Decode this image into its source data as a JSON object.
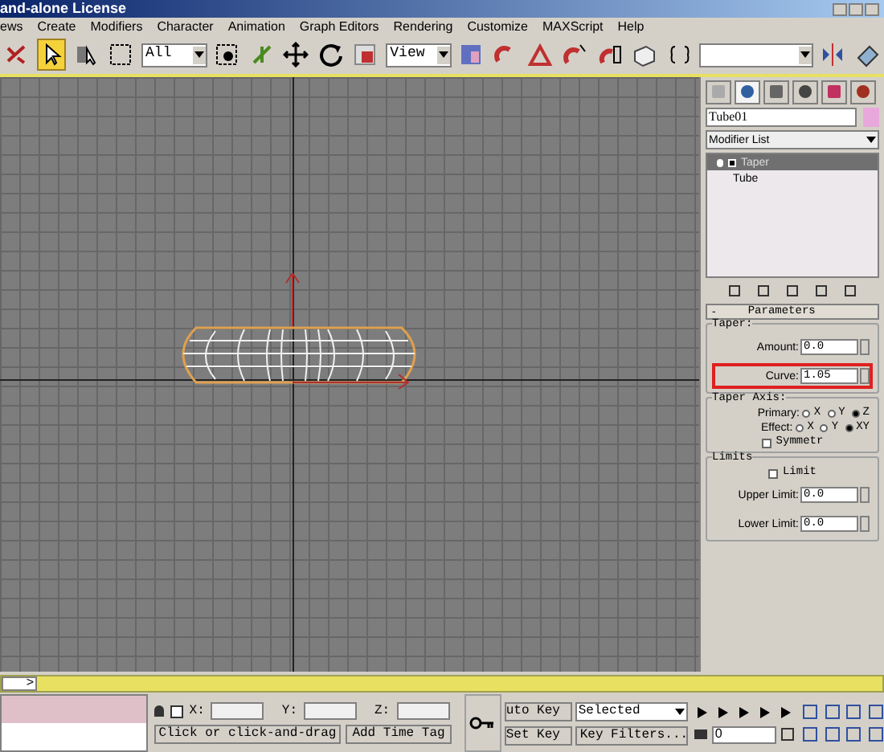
{
  "window": {
    "title": "and-alone License"
  },
  "menu": [
    "ews",
    "Create",
    "Modifiers",
    "Character",
    "Animation",
    "Graph Editors",
    "Rendering",
    "Customize",
    "MAXScript",
    "Help"
  ],
  "toolbar": {
    "tools": [
      {
        "kind": "link",
        "selected": false
      },
      {
        "kind": "select",
        "selected": true
      },
      {
        "kind": "select-name",
        "selected": false
      },
      {
        "kind": "region",
        "selected": false
      },
      {
        "kind": "filter",
        "value": "All"
      },
      {
        "kind": "target",
        "selected": false
      },
      {
        "kind": "manipulate",
        "selected": false
      },
      {
        "kind": "move",
        "selected": false
      },
      {
        "kind": "rotate",
        "selected": false
      },
      {
        "kind": "scale",
        "selected": false
      },
      {
        "kind": "filter",
        "value": "View"
      },
      {
        "kind": "pivot",
        "selected": false
      },
      {
        "kind": "snap",
        "selected": false
      },
      {
        "kind": "angle",
        "selected": false
      },
      {
        "kind": "percent",
        "selected": false
      },
      {
        "kind": "spinner",
        "selected": false
      },
      {
        "kind": "render",
        "selected": false
      },
      {
        "kind": "named",
        "selected": false
      },
      {
        "kind": "filter"
      },
      {
        "kind": "mirror",
        "selected": false
      },
      {
        "kind": "eraser",
        "selected": false
      }
    ]
  },
  "command_panel": {
    "object_name": "Tube01",
    "tabs": [
      {
        "selected": false
      },
      {
        "selected": true
      },
      {
        "selected": false
      },
      {
        "selected": false
      },
      {
        "selected": false
      },
      {
        "selected": false
      }
    ],
    "modifier_list": "Modifier List",
    "stack": [
      {
        "label": "Taper",
        "selected": true
      },
      {
        "label": "Tube",
        "selected": false
      }
    ],
    "rollout": {
      "title": "Parameters",
      "collapse": "-",
      "taper": {
        "label": "Taper:",
        "fields": [
          {
            "label": "Amount:",
            "value": "0.0",
            "highlighted": false
          },
          {
            "label": "Curve:",
            "value": "1.05",
            "highlighted": true
          }
        ]
      },
      "axis": {
        "label": "Taper Axis:",
        "rows": [
          {
            "label": "Primary:",
            "options": [
              {
                "label": "X",
                "selected": false
              },
              {
                "label": "Y",
                "selected": false
              },
              {
                "label": "Z",
                "selected": true
              }
            ]
          },
          {
            "label": "Effect:",
            "options": [
              {
                "label": "X",
                "selected": false
              },
              {
                "label": "Y",
                "selected": false
              },
              {
                "label": "XY",
                "selected": true
              }
            ]
          }
        ],
        "symmetry": {
          "label": "Symmetr",
          "checked": false
        }
      },
      "limits": {
        "label": "Limits",
        "limit": {
          "label": "Limit",
          "checked": false
        },
        "fields": [
          {
            "label": "Upper Limit:",
            "value": "0.0"
          },
          {
            "label": "Lower Limit:",
            "value": "0.0"
          }
        ]
      }
    }
  },
  "timeline": {
    "arrow": ">",
    "level": 0
  },
  "status": {
    "coords": [
      {
        "label": "X:"
      },
      {
        "label": "Y:"
      },
      {
        "label": "Z:"
      }
    ],
    "prompt": "Click or click-and-drag",
    "add_time_tag": "Add Time Tag",
    "auto_key": "uto Key",
    "set_key": "Set Key",
    "key_mode": "Selected",
    "key_filters": "Key Filters...",
    "frame": "0"
  }
}
